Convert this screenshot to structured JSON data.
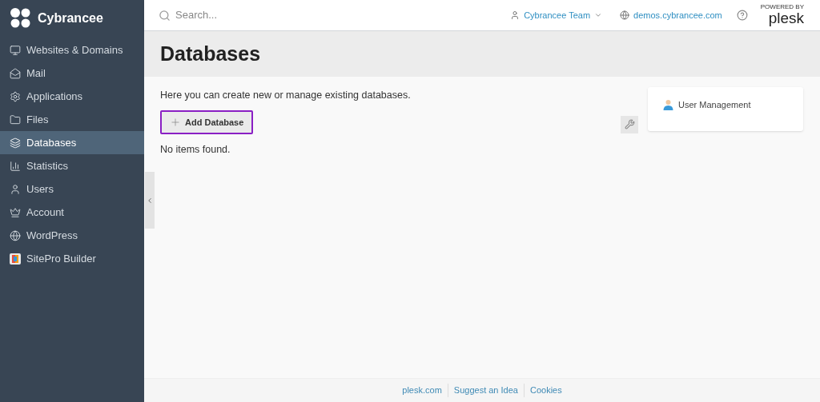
{
  "brand": {
    "name": "Cybrancee"
  },
  "sidebar": {
    "items": [
      {
        "label": "Websites & Domains",
        "selected": false
      },
      {
        "label": "Mail",
        "selected": false
      },
      {
        "label": "Applications",
        "selected": false
      },
      {
        "label": "Files",
        "selected": false
      },
      {
        "label": "Databases",
        "selected": true
      },
      {
        "label": "Statistics",
        "selected": false
      },
      {
        "label": "Users",
        "selected": false
      },
      {
        "label": "Account",
        "selected": false
      },
      {
        "label": "WordPress",
        "selected": false
      },
      {
        "label": "SitePro Builder",
        "selected": false
      }
    ]
  },
  "header": {
    "search": {
      "placeholder": "Search..."
    },
    "account": "Cybrancee Team",
    "domain": "demos.cybrancee.com",
    "powered_by": "POWERED BY",
    "product": "plesk"
  },
  "page": {
    "title": "Databases",
    "description": "Here you can create new or manage existing databases.",
    "add_button": "Add Database",
    "empty_message": "No items found.",
    "side_links": [
      "User Management"
    ]
  },
  "footer": {
    "links": [
      "plesk.com",
      "Suggest an Idea",
      "Cookies"
    ]
  }
}
